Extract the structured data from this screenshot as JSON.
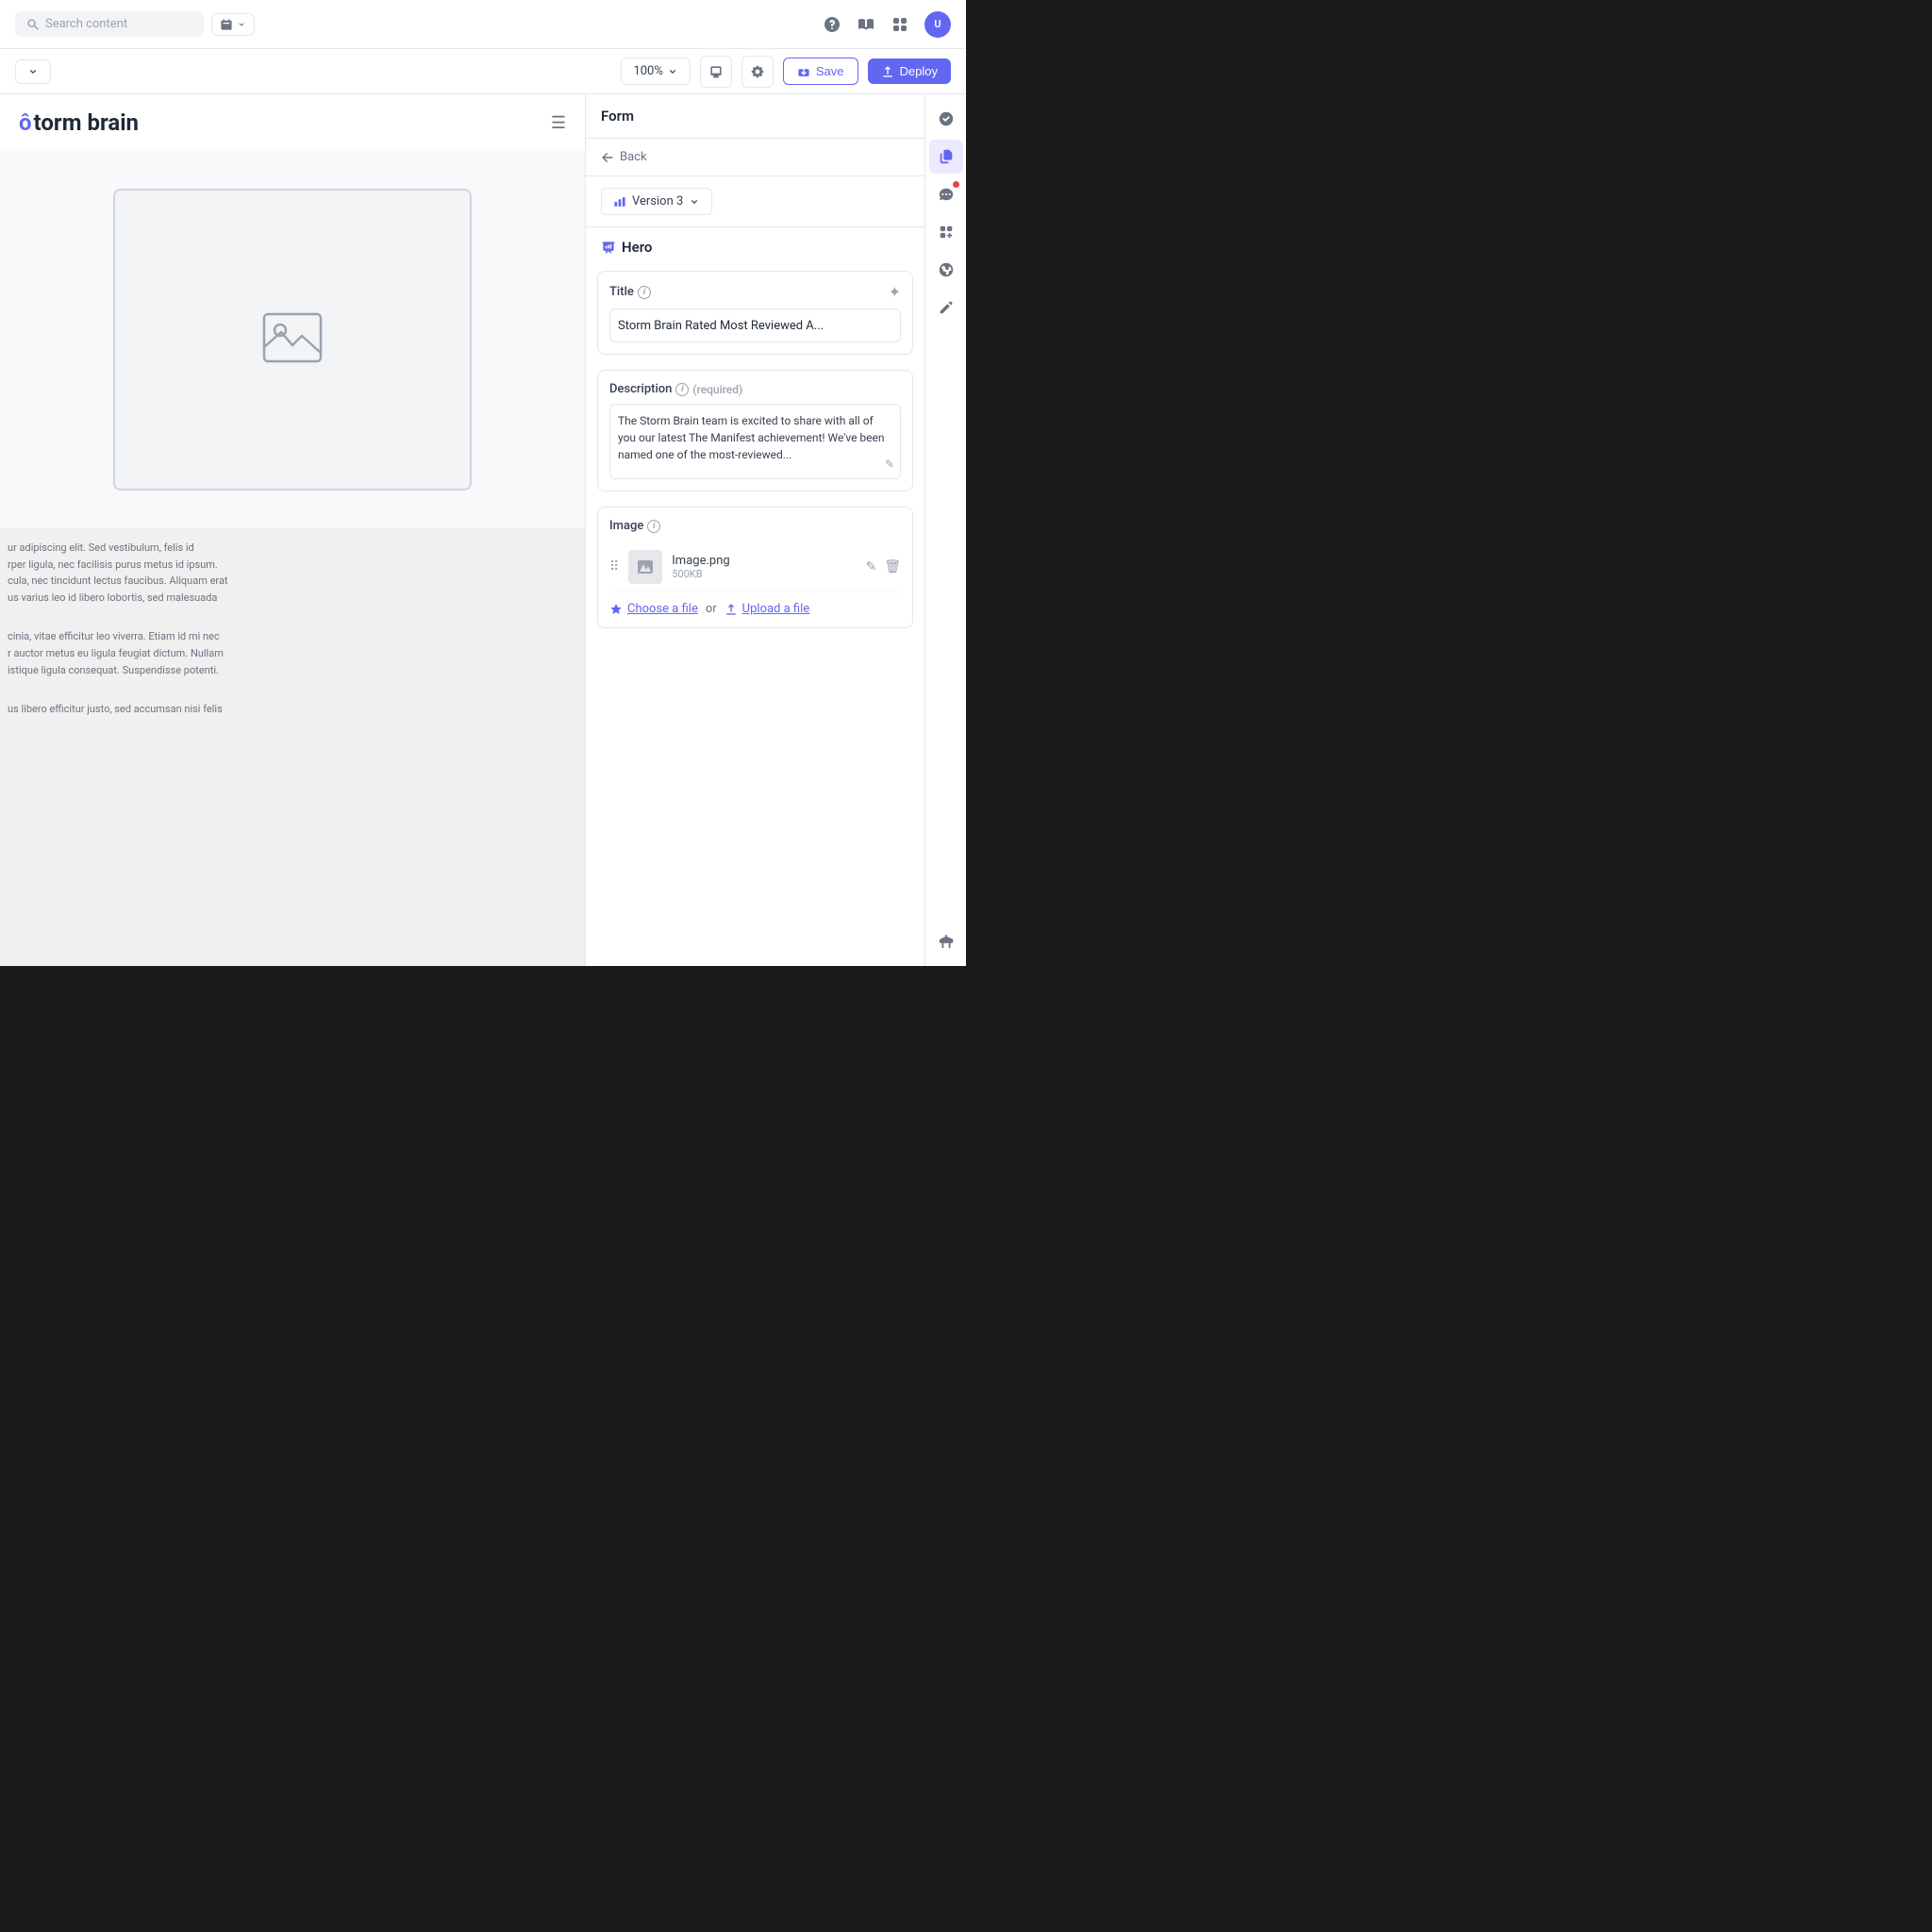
{
  "topNav": {
    "search": {
      "placeholder": "Search content"
    },
    "icons": [
      "calendar",
      "filter",
      "help",
      "book",
      "grid",
      "user"
    ]
  },
  "toolbar": {
    "dropdown_label": "",
    "zoom_label": "100%",
    "save_label": "Save",
    "deploy_label": "Deploy"
  },
  "panel": {
    "title": "Form",
    "back_label": "Back",
    "version_label": "Version 3",
    "section_title": "Hero",
    "title_field": {
      "label": "Title",
      "value": "Storm Brain Rated Most Reviewed A..."
    },
    "description_field": {
      "label": "Description",
      "required": "(required)",
      "value": "The Storm Brain team is excited to share with all of you our latest The Manifest achievement! We've been named one of the most-reviewed..."
    },
    "image_field": {
      "label": "Image",
      "file_name": "Image.png",
      "file_size": "500KB",
      "choose_file_label": "Choose a file",
      "or_label": "or",
      "upload_file_label": "Upload a file"
    }
  },
  "canvas": {
    "brand_name": "torm brain",
    "text_preview_1": "ur adipiscing elit. Sed vestibulum, felis id\nrper ligula, nec facilisis purus metus id ipsum.\ncula, nec tincidunt lectus faucibus. Aliquam erat\nus varius leo id libero lobortis, sed malesuada",
    "text_preview_2": "cinia, vitae efficitur leo viverra. Etiam id mi nec\nr auctor metus eu ligula feugiat dictum. Nullam\nistique ligula consequat. Suspendisse potenti.",
    "text_preview_3": "us libero efficitur justo, sed accumsan nisi felis"
  }
}
